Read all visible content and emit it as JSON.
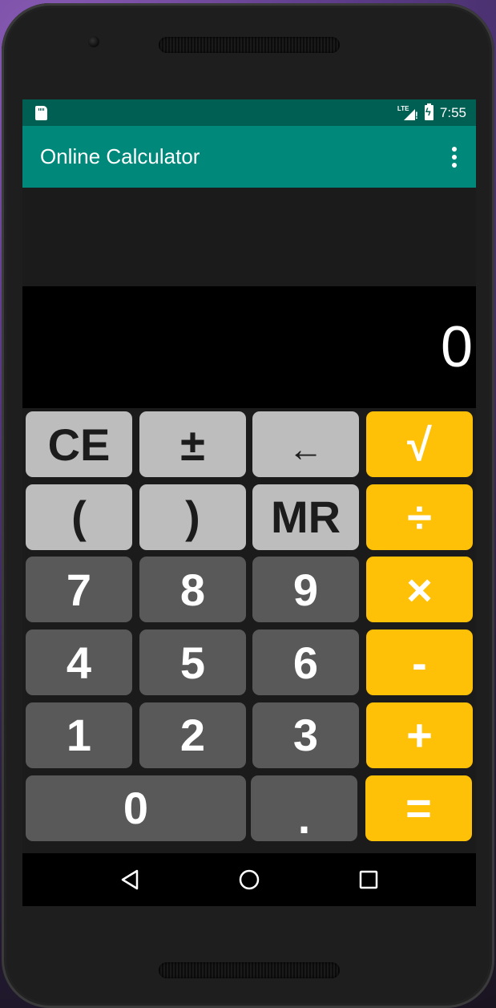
{
  "status_bar": {
    "time": "7:55",
    "network_label": "LTE",
    "icons": [
      "sd-card-icon",
      "lte-signal-icon",
      "battery-charging-icon"
    ]
  },
  "app_bar": {
    "title": "Online Calculator",
    "menu_icon": "overflow-menu-icon"
  },
  "display": {
    "value": "0",
    "history": ""
  },
  "keypad": {
    "rows": [
      [
        {
          "id": "clear-entry",
          "label": "CE",
          "style": "light"
        },
        {
          "id": "plus-minus",
          "label": "±",
          "style": "light"
        },
        {
          "id": "backspace",
          "label": "←",
          "style": "light"
        },
        {
          "id": "sqrt",
          "label": "√",
          "style": "accent"
        }
      ],
      [
        {
          "id": "open-paren",
          "label": "(",
          "style": "light"
        },
        {
          "id": "close-paren",
          "label": ")",
          "style": "light"
        },
        {
          "id": "memory-recall",
          "label": "MR",
          "style": "light"
        },
        {
          "id": "divide",
          "label": "÷",
          "style": "accent"
        }
      ],
      [
        {
          "id": "digit-7",
          "label": "7",
          "style": "dark"
        },
        {
          "id": "digit-8",
          "label": "8",
          "style": "dark"
        },
        {
          "id": "digit-9",
          "label": "9",
          "style": "dark"
        },
        {
          "id": "multiply",
          "label": "×",
          "style": "accent"
        }
      ],
      [
        {
          "id": "digit-4",
          "label": "4",
          "style": "dark"
        },
        {
          "id": "digit-5",
          "label": "5",
          "style": "dark"
        },
        {
          "id": "digit-6",
          "label": "6",
          "style": "dark"
        },
        {
          "id": "subtract",
          "label": "-",
          "style": "accent"
        }
      ],
      [
        {
          "id": "digit-1",
          "label": "1",
          "style": "dark"
        },
        {
          "id": "digit-2",
          "label": "2",
          "style": "dark"
        },
        {
          "id": "digit-3",
          "label": "3",
          "style": "dark"
        },
        {
          "id": "add",
          "label": "+",
          "style": "accent"
        }
      ],
      [
        {
          "id": "digit-0",
          "label": "0",
          "style": "dark"
        },
        {
          "id": "decimal",
          "label": ".",
          "style": "dark"
        },
        {
          "id": "equals",
          "label": "=",
          "style": "accent"
        }
      ]
    ]
  },
  "nav_bar": {
    "buttons": [
      "back",
      "home",
      "recents"
    ]
  },
  "colors": {
    "status_bar": "#005f53",
    "app_bar": "#00897b",
    "accent_key": "#ffc107",
    "function_key": "#bdbdbd",
    "digit_key": "#595959",
    "display_bg": "#000000"
  }
}
